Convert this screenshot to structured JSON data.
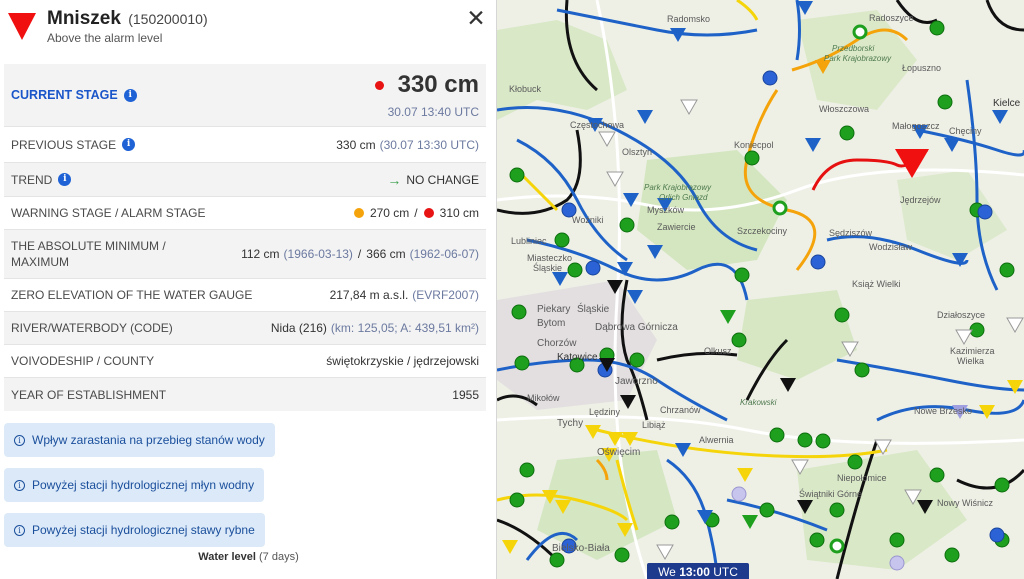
{
  "station": {
    "name": "Mniszek",
    "code": "(150200010)",
    "status": "Above the alarm level"
  },
  "rows": {
    "current": {
      "label": "CURRENT STAGE",
      "value": "330 cm",
      "time": "30.07 13:40 UTC"
    },
    "previous": {
      "label": "PREVIOUS STAGE",
      "value": "330 cm",
      "time": "(30.07 13:30 UTC)"
    },
    "trend": {
      "label": "TREND",
      "arrow": "→",
      "value": "NO CHANGE"
    },
    "warning": {
      "label": "WARNING STAGE / ALARM STAGE",
      "warning_value": "270 cm",
      "separator": "/",
      "alarm_value": "310 cm"
    },
    "absolute": {
      "label_line1": "THE ABSOLUTE MINIMUM /",
      "label_line2": "MAXIMUM",
      "min_value": "112 cm",
      "min_date": "(1966-03-13)",
      "separator": "/",
      "max_value": "366 cm",
      "max_date": "(1962-06-07)"
    },
    "zero": {
      "label": "ZERO ELEVATION OF THE WATER GAUGE",
      "value": "217,84 m a.s.l.",
      "datum": "(EVRF2007)"
    },
    "river": {
      "label": "RIVER/WATERBODY (CODE)",
      "value": "Nida (216)",
      "details": "(km: 125,05; A: 439,51 km²)"
    },
    "voivodeship": {
      "label": "VOIVODESHIP / COUNTY",
      "value": "świętokrzyskie / jędrzejowski"
    },
    "year": {
      "label": "YEAR OF ESTABLISHMENT",
      "value": "1955"
    }
  },
  "notes": [
    "Wpływ zarastania na przebieg stanów wody",
    "Powyżej stacji hydrologicznej młyn wodny",
    "Powyżej stacji hydrologicznej stawy rybne"
  ],
  "water_level": {
    "title": "Water level",
    "range": "(7 days)"
  },
  "map": {
    "time_badge": {
      "day": "We",
      "time": "13:00",
      "tz": "UTC"
    },
    "labels": {
      "radomsko": "Radomsko",
      "radoszyce": "Radoszyce",
      "przedborski": "Przedborski",
      "park_krajobrazowy": "Park Krajobrazowy",
      "lopuszno": "Łopuszno",
      "klobuck": "Kłobuck",
      "wloszczowa": "Włoszczowa",
      "kielce": "Kielce",
      "czestochowa": "Częstochowa",
      "olsztyn": "Olsztyn",
      "koniecpol": "Koniecpol",
      "malogoszcz": "Małogoszcz",
      "checiny": "Chęciny",
      "park_krajobrazowy_orlich": "Park Krajobrazowy",
      "orlich_gniazd": "Orlich Gniazd",
      "jedrzejow": "Jędrzejów",
      "wozniki": "Woźniki",
      "zawiercie": "Zawiercie",
      "szczekociny": "Szczekociny",
      "sedziszow": "Sędziszów",
      "myszkow": "Myszków",
      "wodzislaw": "Wodzisław",
      "miasteczko": "Miasteczko",
      "slaskie": "Śląskie",
      "lubliniec": "Lubliniec",
      "ksiaz_wielki": "Książ Wielki",
      "piekary": "Piekary",
      "slaskie2": "Śląskie",
      "bytom": "Bytom",
      "dabrowa": "Dąbrowa Górnicza",
      "olkusz": "Olkusz",
      "dzialoszyce": "Działoszyce",
      "chorzow": "Chorzów",
      "katowice": "Katowice",
      "kazimierza": "Kazimierza",
      "wielka": "Wielka",
      "jaworzno": "Jaworzno",
      "mikolow": "Mikołów",
      "ledziny": "Lędziny",
      "chrzanow": "Chrzanów",
      "nowe_brzesko": "Nowe Brzesko",
      "tychy": "Tychy",
      "libiaz": "Libiąż",
      "alwernia": "Alwernia",
      "oswiecim": "Oświęcim",
      "niepolomice": "Niepołomice",
      "swiatniki": "Świątniki Górne",
      "bielsko": "Bielsko-Biała",
      "nowy_wisnicz": "Nowy Wiśnicz",
      "krakowski": "Krakowski"
    }
  }
}
